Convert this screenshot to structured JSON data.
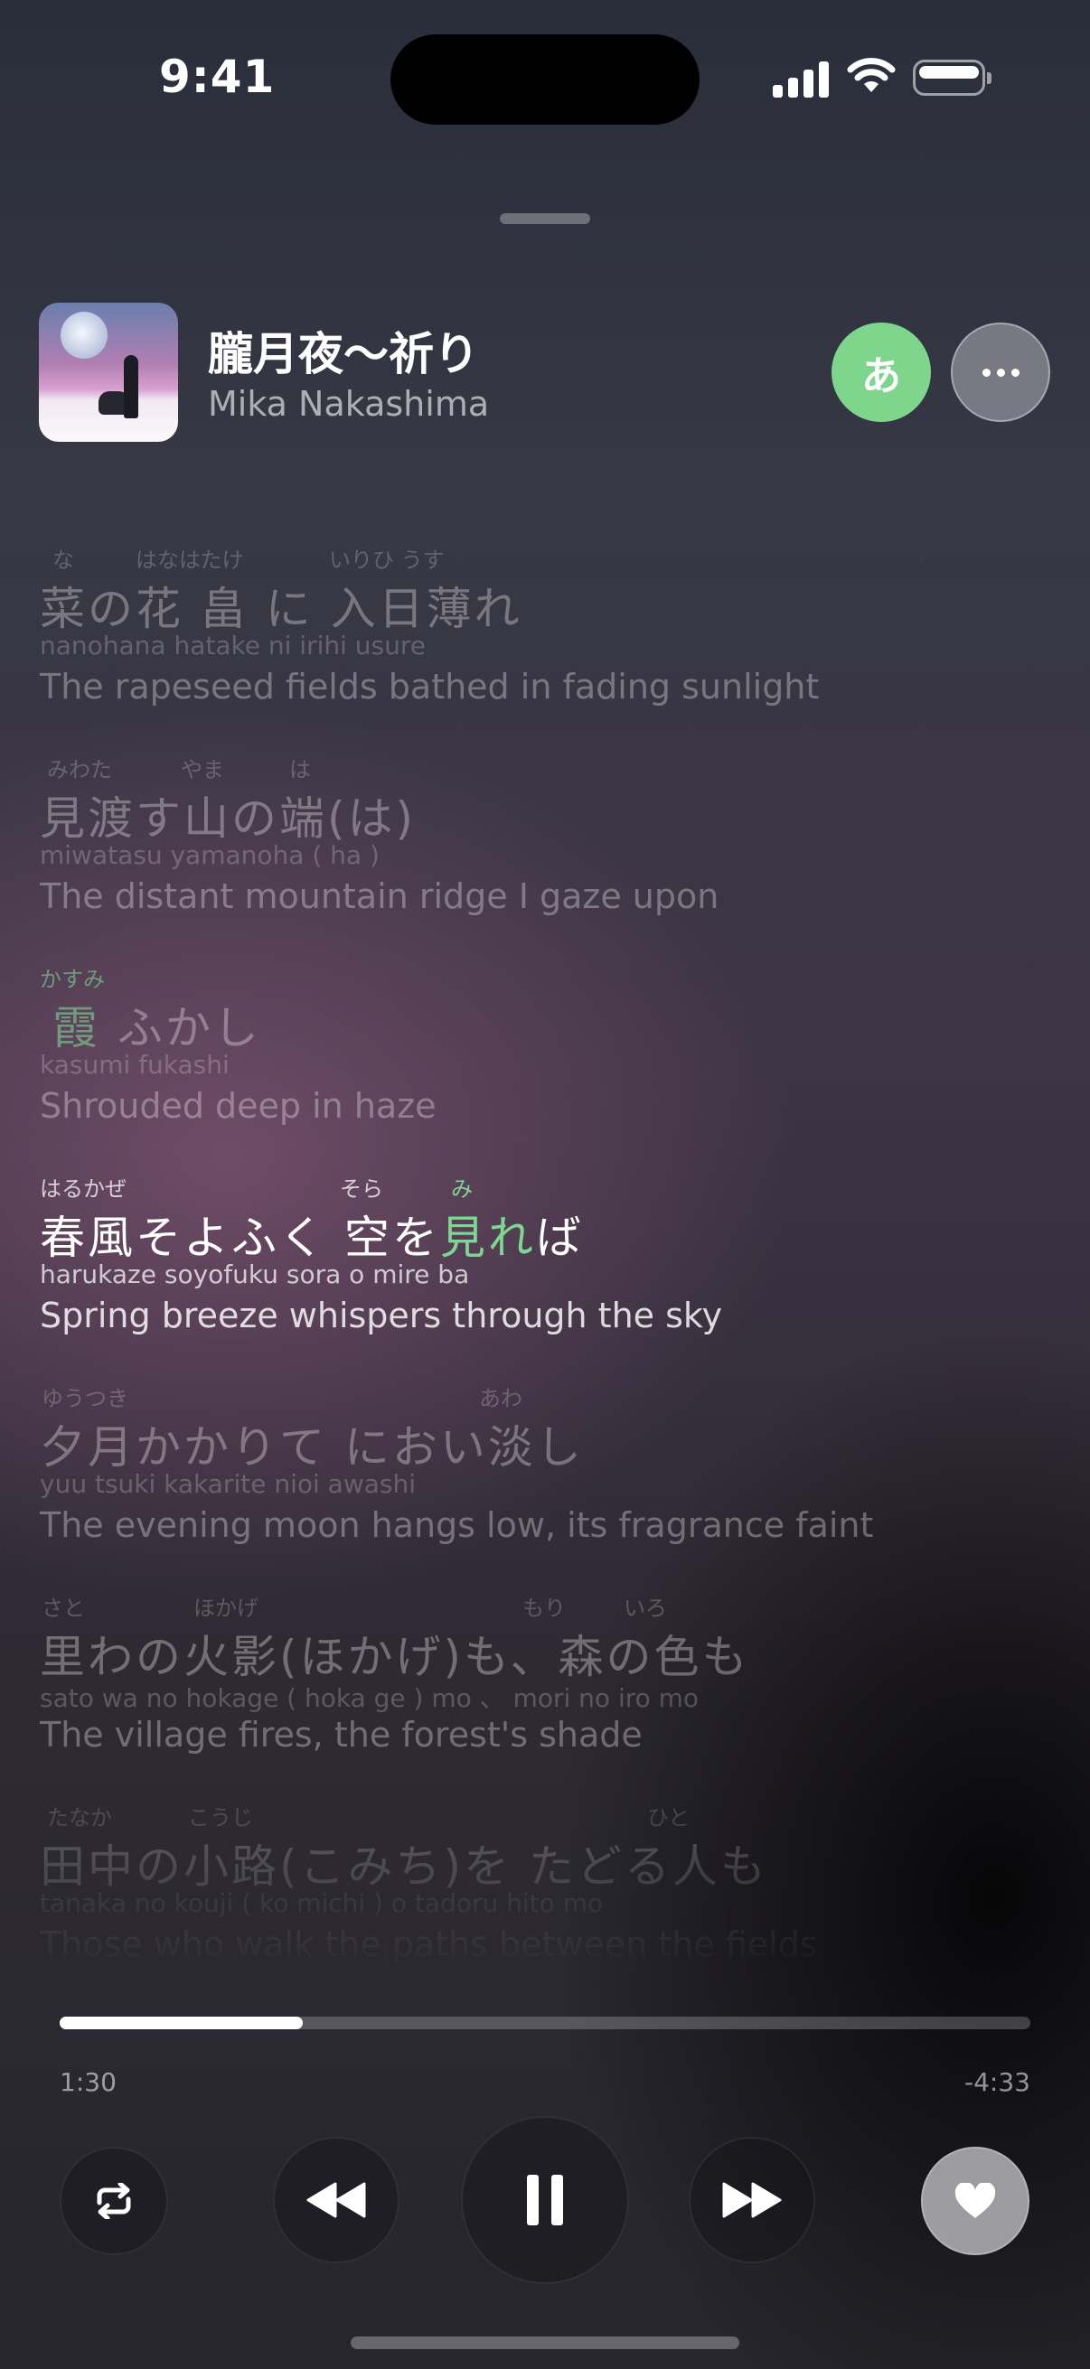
{
  "status": {
    "time": "9:41"
  },
  "now_playing": {
    "title": "朧月夜〜祈り",
    "artist": "Mika Nakashima",
    "kana_button": "あ",
    "accent_color": "#7ed692"
  },
  "lyrics": [
    {
      "ruby": [
        "な",
        "はなはたけ",
        "いりひ うす"
      ],
      "text": "菜の花 畠 に 入日薄れ",
      "romaji": "nanohana hatake ni irihi usure",
      "translation": "The rapeseed fields bathed in fading sunlight"
    },
    {
      "ruby": [
        "みわた",
        "やま",
        "は"
      ],
      "text": "見渡す山の端(は)",
      "romaji": "miwatasu yamanoha ( ha )",
      "translation": "The distant mountain ridge I gaze upon"
    },
    {
      "ruby": [
        "かすみ"
      ],
      "text_highlight": "霞",
      "text_rest": " ふかし",
      "romaji": "kasumi fukashi",
      "translation": "Shrouded deep in haze"
    },
    {
      "ruby": [
        "はるかぜ",
        "そら",
        "み"
      ],
      "text_before": "春風そよふく 空を",
      "text_highlight": "見れ",
      "text_after": "ば",
      "romaji": "harukaze soyofuku sora o mire ba",
      "translation": "Spring breeze whispers through the sky",
      "active": true
    },
    {
      "ruby": [
        "ゆうつき",
        "あわ"
      ],
      "text": "夕月かかりて におい淡し",
      "romaji": "yuu tsuki kakarite nioi awashi",
      "translation": "The evening moon hangs low, its fragrance faint"
    },
    {
      "ruby": [
        "さと",
        "ほかげ",
        "もり",
        "いろ"
      ],
      "text": "里わの火影(ほかげ)も、森の色も",
      "romaji": "sato wa no hokage ( hoka ge ) mo 、 mori no iro mo",
      "translation": "The village fires, the forest's shade"
    },
    {
      "ruby": [
        "たなか",
        "こうじ",
        "ひと"
      ],
      "text": "田中の小路(こみち)を たどる人も",
      "romaji": "tanaka no kouji ( ko michi ) o tadoru hito mo",
      "translation": "Those who walk the paths between the fields"
    }
  ],
  "playback": {
    "elapsed": "1:30",
    "remaining": "-4:33",
    "progress": 0.25
  },
  "controls": {
    "repeat": "repeat-icon",
    "previous": "backward-icon",
    "play_pause": "pause-icon",
    "next": "forward-icon",
    "like": "heart-icon"
  }
}
